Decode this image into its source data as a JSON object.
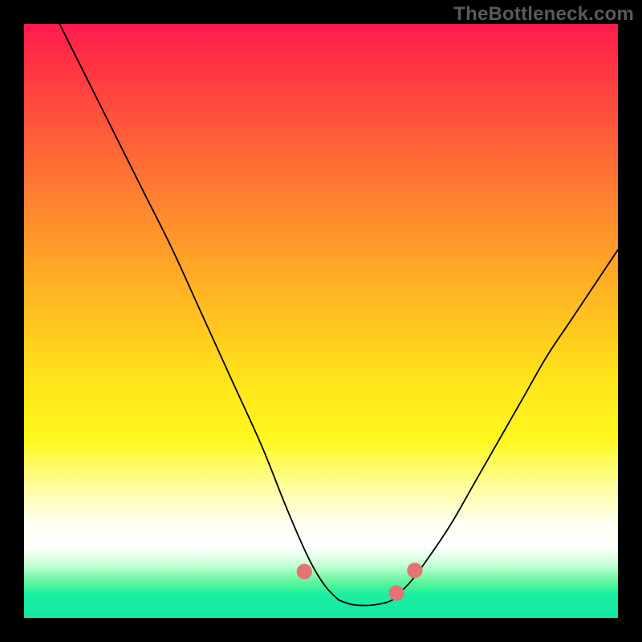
{
  "watermark": "TheBottleneck.com",
  "colors": {
    "good": "#12e7a4",
    "bad": "#ff1a4f",
    "marker": "#e57373",
    "curve": "#000000"
  },
  "chart_data": {
    "type": "line",
    "title": "",
    "xlabel": "",
    "ylabel": "",
    "xlim": [
      0,
      100
    ],
    "ylim": [
      0,
      100
    ],
    "grid": false,
    "axes_visible": false,
    "series": [
      {
        "name": "left-curve",
        "x": [
          6,
          10,
          15,
          20,
          25,
          30,
          35,
          40,
          44,
          47,
          49,
          51,
          53
        ],
        "y": [
          100,
          92,
          82,
          72,
          62,
          51,
          40,
          29,
          19,
          12,
          8,
          5,
          3
        ]
      },
      {
        "name": "right-curve",
        "x": [
          62,
          65,
          68,
          72,
          76,
          80,
          84,
          88,
          92,
          96,
          100
        ],
        "y": [
          3,
          6,
          10,
          16,
          23,
          30,
          37,
          44,
          50,
          56,
          62
        ]
      },
      {
        "name": "valley-floor",
        "x": [
          53,
          55,
          57,
          59,
          61,
          62
        ],
        "y": [
          3,
          2.3,
          2.1,
          2.2,
          2.6,
          3
        ]
      }
    ],
    "markers": [
      {
        "shape": "pill",
        "x0": 43.5,
        "y0": 14.5,
        "x1": 46.0,
        "y1": 10.0
      },
      {
        "shape": "circle",
        "cx": 47.2,
        "cy": 7.8,
        "r": 1.3
      },
      {
        "shape": "pill",
        "x0": 48.2,
        "y0": 6.4,
        "x1": 50.2,
        "y1": 4.0
      },
      {
        "shape": "pill",
        "x0": 51.0,
        "y0": 3.0,
        "x1": 60.8,
        "y1": 2.6
      },
      {
        "shape": "circle",
        "cx": 62.7,
        "cy": 4.2,
        "r": 1.3
      },
      {
        "shape": "circle",
        "cx": 65.8,
        "cy": 8.0,
        "r": 1.3
      }
    ]
  }
}
